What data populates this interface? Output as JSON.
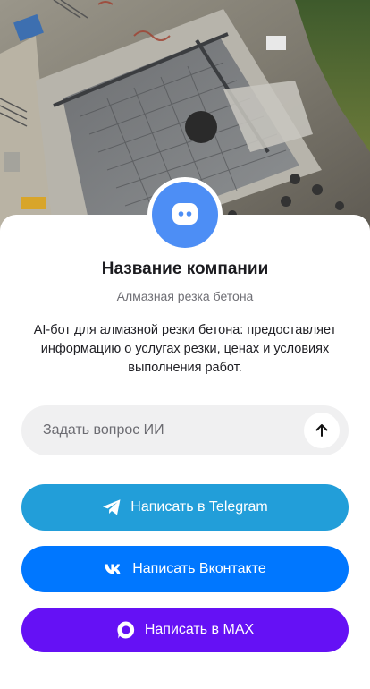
{
  "hero": {
    "image_icon": "construction-site-photo"
  },
  "profile": {
    "avatar_icon": "chat-bot-icon",
    "avatar_color": "#4d8ef5",
    "company_name": "Название компании",
    "subtitle": "Алмазная резка бетона",
    "description": "AI-бот для алмазной резки бетона: предоставляет информацию о услугах резки, ценах и условиях выполнения работ."
  },
  "ask": {
    "placeholder": "Задать вопрос ИИ",
    "value": "",
    "send_icon": "arrow-up-icon"
  },
  "actions": [
    {
      "label": "Написать в Telegram",
      "icon": "telegram-icon",
      "color": "#229ed9"
    },
    {
      "label": "Написать Вконтакте",
      "icon": "vk-icon",
      "color": "#0077ff"
    },
    {
      "label": "Написать в MAX",
      "icon": "max-icon",
      "color": "#6511f5"
    }
  ]
}
